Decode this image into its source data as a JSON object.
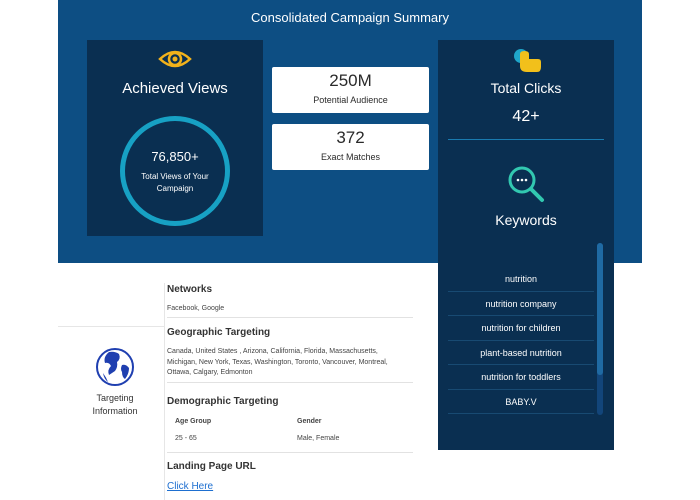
{
  "header": {
    "title": "Consolidated Campaign Summary"
  },
  "views": {
    "icon": "eye-icon",
    "title": "Achieved Views",
    "value": "76,850+",
    "caption": "Total Views of Your Campaign"
  },
  "audience": {
    "value": "250M",
    "label": "Potential Audience"
  },
  "matches": {
    "value": "372",
    "label": "Exact Matches"
  },
  "clicks": {
    "icon": "pointer-icon",
    "title": "Total Clicks",
    "value": "42+"
  },
  "keywords": {
    "icon": "search-icon",
    "title": "Keywords",
    "items": [
      "nutrition",
      "nutrition company",
      "nutrition for children",
      "plant-based nutrition",
      "nutrition for toddlers",
      "BABY.V"
    ]
  },
  "targeting": {
    "icon": "globe-icon",
    "label": "Targeting Information",
    "networks": {
      "title": "Networks",
      "value": "Facebook, Google"
    },
    "geo": {
      "title": "Geographic Targeting",
      "value": "Canada, United States , Arizona, California, Florida, Massachusetts, Michigan, New York, Texas, Washington, Toronto, Vancouver, Montreal, Ottawa, Calgary, Edmonton"
    },
    "demographic": {
      "title": "Demographic Targeting",
      "age_header": "Age Group",
      "gender_header": "Gender",
      "age_value": "25 - 65",
      "gender_value": "Male, Female"
    },
    "landing": {
      "title": "Landing Page URL",
      "link_text": "Click Here"
    }
  },
  "colors": {
    "band": "#0d4e83",
    "card": "#0a2f51",
    "ring": "#17a1c4",
    "eye": "#f2b21b",
    "link": "#1e6fd0"
  }
}
